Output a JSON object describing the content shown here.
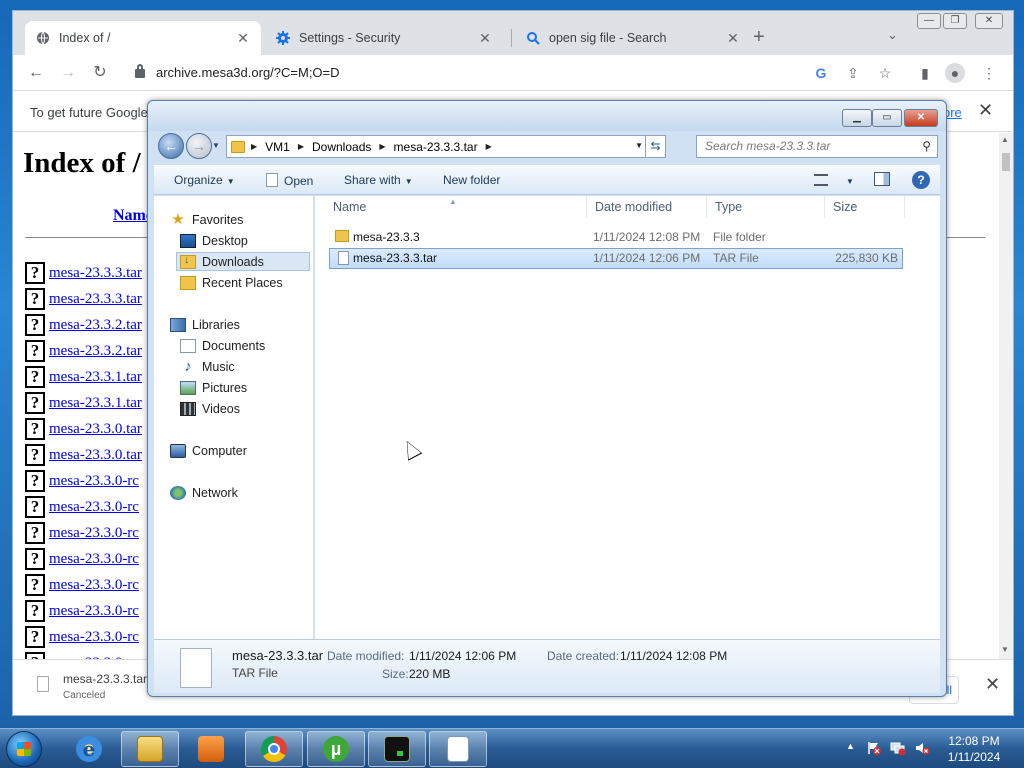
{
  "browser": {
    "tabs": [
      {
        "title": "Index of /",
        "icon": "globe-icon",
        "active": true
      },
      {
        "title": "Settings - Security",
        "icon": "gear-icon",
        "active": false
      },
      {
        "title": "open sig file - Search",
        "icon": "search-icon",
        "active": false
      }
    ],
    "new_tab": "+",
    "url": "archive.mesa3d.org/?C=M;O=D",
    "infobar": {
      "text": "To get future Google",
      "link": "ore"
    },
    "page": {
      "heading": "Index of /",
      "column_name": "Name",
      "files": [
        "mesa-23.3.3.tar",
        "mesa-23.3.3.tar",
        "mesa-23.3.2.tar",
        "mesa-23.3.2.tar",
        "mesa-23.3.1.tar",
        "mesa-23.3.1.tar",
        "mesa-23.3.0.tar",
        "mesa-23.3.0.tar",
        "mesa-23.3.0-rc",
        "mesa-23.3.0-rc",
        "mesa-23.3.0-rc",
        "mesa-23.3.0-rc",
        "mesa-23.3.0-rc",
        "mesa-23.3.0-rc",
        "mesa-23.3.0-rc",
        "mesa-23.3.0-rc"
      ]
    },
    "download": {
      "name": "mesa-23.3.3.tar",
      "status": "Canceled",
      "show_all": "all"
    }
  },
  "explorer": {
    "breadcrumb": [
      "VM1",
      "Downloads",
      "mesa-23.3.3.tar"
    ],
    "search_placeholder": "Search mesa-23.3.3.tar",
    "commands": {
      "organize": "Organize",
      "open": "Open",
      "share_with": "Share with",
      "new_folder": "New folder"
    },
    "nav": {
      "favorites": "Favorites",
      "desktop": "Desktop",
      "downloads": "Downloads",
      "recent_places": "Recent Places",
      "libraries": "Libraries",
      "documents": "Documents",
      "music": "Music",
      "pictures": "Pictures",
      "videos": "Videos",
      "computer": "Computer",
      "network": "Network"
    },
    "columns": {
      "name": "Name",
      "date_modified": "Date modified",
      "type": "Type",
      "size": "Size"
    },
    "rows": [
      {
        "name": "mesa-23.3.3",
        "date": "1/11/2024 12:08 PM",
        "type": "File folder",
        "size": ""
      },
      {
        "name": "mesa-23.3.3.tar",
        "date": "1/11/2024 12:06 PM",
        "type": "TAR File",
        "size": "225,830 KB"
      }
    ],
    "details": {
      "name": "mesa-23.3.3.tar",
      "type": "TAR File",
      "date_modified_label": "Date modified:",
      "date_modified": "1/11/2024 12:06 PM",
      "date_created_label": "Date created:",
      "date_created": "1/11/2024 12:08 PM",
      "size_label": "Size:",
      "size": "220 MB"
    }
  },
  "taskbar": {
    "clock_time": "12:08 PM",
    "clock_date": "1/11/2024"
  }
}
